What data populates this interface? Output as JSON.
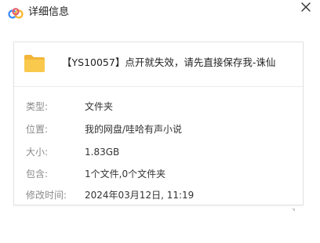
{
  "window": {
    "title": "详细信息",
    "accent_color": "#4a8cf7"
  },
  "icons": {
    "app_logo": "cloud-logo-icon",
    "close": "close-icon",
    "folder": "folder-icon"
  },
  "file": {
    "name": "【YS10057】点开就失效，请先直接保存我-诛仙",
    "folder_color": "#f7c94a"
  },
  "details": [
    {
      "label": "类型:",
      "value": "文件夹"
    },
    {
      "label": "位置:",
      "value": "我的网盘/哇哈有声小说"
    },
    {
      "label": "大小:",
      "value": "1.83GB"
    },
    {
      "label": "包含:",
      "value": "1个文件,0个文件夹"
    },
    {
      "label": "修改时间:",
      "value": "2024年03月12日, 11:19"
    }
  ]
}
